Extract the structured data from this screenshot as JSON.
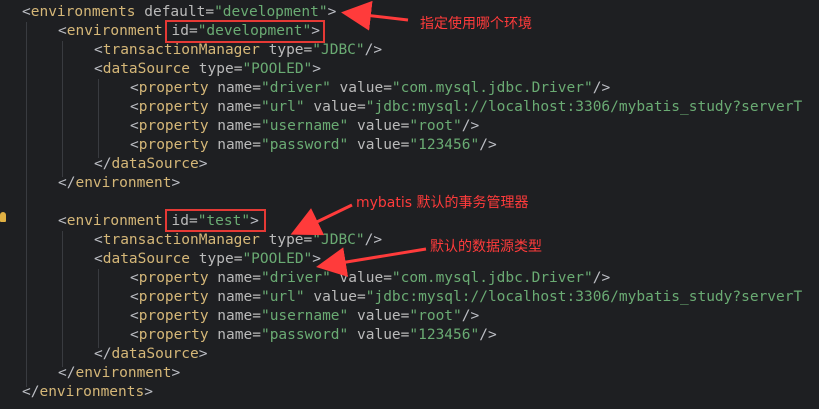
{
  "code_lines": [
    {
      "indent": 0,
      "parts": [
        [
          "br",
          "<"
        ],
        [
          "tag",
          "environments"
        ],
        [
          "attr",
          " default="
        ],
        [
          "val",
          "\"development\""
        ],
        [
          "br",
          ">"
        ]
      ]
    },
    {
      "indent": 1,
      "parts": [
        [
          "br",
          "<"
        ],
        [
          "tag",
          "environment"
        ],
        [
          "attr",
          " id="
        ],
        [
          "val",
          "\"development\""
        ],
        [
          "br",
          ">"
        ]
      ]
    },
    {
      "indent": 2,
      "parts": [
        [
          "br",
          "<"
        ],
        [
          "tag",
          "transactionManager"
        ],
        [
          "attr",
          " type="
        ],
        [
          "val",
          "\"JDBC\""
        ],
        [
          "br",
          "/>"
        ]
      ]
    },
    {
      "indent": 2,
      "parts": [
        [
          "br",
          "<"
        ],
        [
          "tag",
          "dataSource"
        ],
        [
          "attr",
          " type="
        ],
        [
          "val",
          "\"POOLED\""
        ],
        [
          "br",
          ">"
        ]
      ]
    },
    {
      "indent": 3,
      "parts": [
        [
          "br",
          "<"
        ],
        [
          "tag",
          "property"
        ],
        [
          "attr",
          " name="
        ],
        [
          "val",
          "\"driver\""
        ],
        [
          "attr",
          " value="
        ],
        [
          "val",
          "\"com.mysql.jdbc.Driver\""
        ],
        [
          "br",
          "/>"
        ]
      ]
    },
    {
      "indent": 3,
      "parts": [
        [
          "br",
          "<"
        ],
        [
          "tag",
          "property"
        ],
        [
          "attr",
          " name="
        ],
        [
          "val",
          "\"url\""
        ],
        [
          "attr",
          " value="
        ],
        [
          "val",
          "\"jdbc:mysql://localhost:3306/mybatis_study?serverT"
        ]
      ]
    },
    {
      "indent": 3,
      "parts": [
        [
          "br",
          "<"
        ],
        [
          "tag",
          "property"
        ],
        [
          "attr",
          " name="
        ],
        [
          "val",
          "\"username\""
        ],
        [
          "attr",
          " value="
        ],
        [
          "val",
          "\"root\""
        ],
        [
          "br",
          "/>"
        ]
      ]
    },
    {
      "indent": 3,
      "parts": [
        [
          "br",
          "<"
        ],
        [
          "tag",
          "property"
        ],
        [
          "attr",
          " name="
        ],
        [
          "val",
          "\"password\""
        ],
        [
          "attr",
          " value="
        ],
        [
          "val",
          "\"123456\""
        ],
        [
          "br",
          "/>"
        ]
      ]
    },
    {
      "indent": 2,
      "parts": [
        [
          "br",
          "</"
        ],
        [
          "tag",
          "dataSource"
        ],
        [
          "br",
          ">"
        ]
      ]
    },
    {
      "indent": 1,
      "parts": [
        [
          "br",
          "</"
        ],
        [
          "tag",
          "environment"
        ],
        [
          "br",
          ">"
        ]
      ]
    },
    {
      "indent": 0,
      "parts": []
    },
    {
      "indent": 1,
      "parts": [
        [
          "br",
          "<"
        ],
        [
          "tag",
          "environment"
        ],
        [
          "attr",
          " id="
        ],
        [
          "val",
          "\"test\""
        ],
        [
          "br",
          ">"
        ]
      ]
    },
    {
      "indent": 2,
      "parts": [
        [
          "br",
          "<"
        ],
        [
          "tag",
          "transactionManager"
        ],
        [
          "attr",
          " type="
        ],
        [
          "val",
          "\"JDBC\""
        ],
        [
          "br",
          "/>"
        ]
      ]
    },
    {
      "indent": 2,
      "parts": [
        [
          "br",
          "<"
        ],
        [
          "tag",
          "dataSource"
        ],
        [
          "attr",
          " type="
        ],
        [
          "val",
          "\"POOLED\""
        ],
        [
          "br",
          ">"
        ]
      ]
    },
    {
      "indent": 3,
      "parts": [
        [
          "br",
          "<"
        ],
        [
          "tag",
          "property"
        ],
        [
          "attr",
          " name="
        ],
        [
          "val",
          "\"driver\""
        ],
        [
          "attr",
          " value="
        ],
        [
          "val",
          "\"com.mysql.jdbc.Driver\""
        ],
        [
          "br",
          "/>"
        ]
      ]
    },
    {
      "indent": 3,
      "parts": [
        [
          "br",
          "<"
        ],
        [
          "tag",
          "property"
        ],
        [
          "attr",
          " name="
        ],
        [
          "val",
          "\"url\""
        ],
        [
          "attr",
          " value="
        ],
        [
          "val",
          "\"jdbc:mysql://localhost:3306/mybatis_study?serverT"
        ]
      ]
    },
    {
      "indent": 3,
      "parts": [
        [
          "br",
          "<"
        ],
        [
          "tag",
          "property"
        ],
        [
          "attr",
          " name="
        ],
        [
          "val",
          "\"username\""
        ],
        [
          "attr",
          " value="
        ],
        [
          "val",
          "\"root\""
        ],
        [
          "br",
          "/>"
        ]
      ]
    },
    {
      "indent": 3,
      "parts": [
        [
          "br",
          "<"
        ],
        [
          "tag",
          "property"
        ],
        [
          "attr",
          " name="
        ],
        [
          "val",
          "\"password\""
        ],
        [
          "attr",
          " value="
        ],
        [
          "val",
          "\"123456\""
        ],
        [
          "br",
          "/>"
        ]
      ]
    },
    {
      "indent": 2,
      "parts": [
        [
          "br",
          "</"
        ],
        [
          "tag",
          "dataSource"
        ],
        [
          "br",
          ">"
        ]
      ]
    },
    {
      "indent": 1,
      "parts": [
        [
          "br",
          "</"
        ],
        [
          "tag",
          "environment"
        ],
        [
          "br",
          ">"
        ]
      ]
    },
    {
      "indent": 0,
      "parts": [
        [
          "br",
          "</"
        ],
        [
          "tag",
          "environments"
        ],
        [
          "br",
          ">"
        ]
      ]
    }
  ],
  "annotations": {
    "specify_env": "指定使用哪个环境",
    "default_tx_manager": "mybatis 默认的事务管理器",
    "default_datasource": "默认的数据源类型"
  },
  "colors": {
    "background": "#1e1f22",
    "tag": "#d5b778",
    "attribute": "#bababa",
    "value": "#6aab73",
    "annotation": "#ff3b3b"
  }
}
